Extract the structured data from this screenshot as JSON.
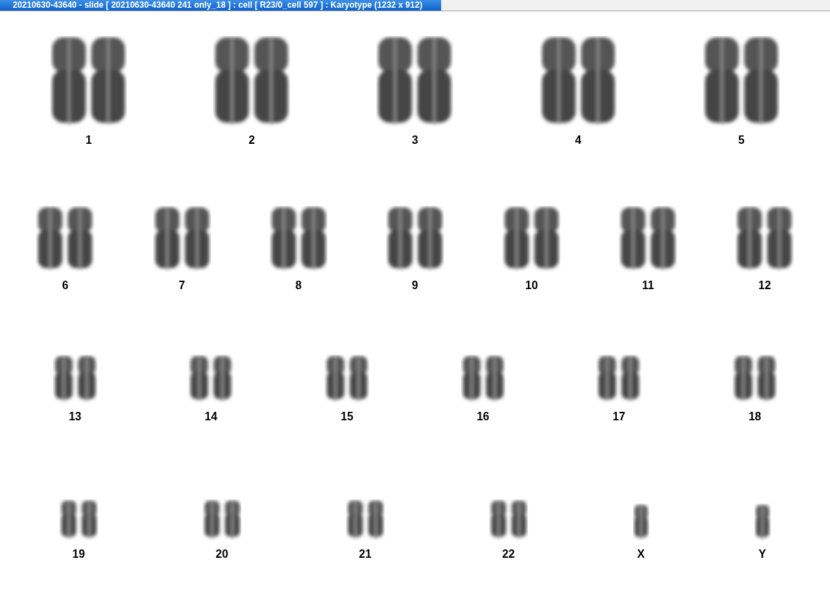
{
  "window": {
    "title": "20210630-43640 - slide [ 20210630-43640 241 only_18 ] : cell [ R23/0_cell 597 ] : Karyotype  (1232 x 912)"
  },
  "karyotype": {
    "rows": [
      {
        "items": [
          {
            "label": "1",
            "kind": "pair"
          },
          {
            "label": "2",
            "kind": "pair"
          },
          {
            "label": "3",
            "kind": "pair"
          },
          {
            "label": "4",
            "kind": "pair"
          },
          {
            "label": "5",
            "kind": "pair"
          }
        ]
      },
      {
        "items": [
          {
            "label": "6",
            "kind": "pair"
          },
          {
            "label": "7",
            "kind": "pair"
          },
          {
            "label": "8",
            "kind": "pair"
          },
          {
            "label": "9",
            "kind": "pair"
          },
          {
            "label": "10",
            "kind": "pair"
          },
          {
            "label": "11",
            "kind": "pair"
          },
          {
            "label": "12",
            "kind": "pair"
          }
        ]
      },
      {
        "items": [
          {
            "label": "13",
            "kind": "pair"
          },
          {
            "label": "14",
            "kind": "pair"
          },
          {
            "label": "15",
            "kind": "pair"
          },
          {
            "label": "16",
            "kind": "pair"
          },
          {
            "label": "17",
            "kind": "pair"
          },
          {
            "label": "18",
            "kind": "pair"
          }
        ]
      },
      {
        "items": [
          {
            "label": "19",
            "kind": "pair"
          },
          {
            "label": "20",
            "kind": "pair"
          },
          {
            "label": "21",
            "kind": "pair"
          },
          {
            "label": "22",
            "kind": "pair"
          },
          {
            "label": "X",
            "kind": "single"
          },
          {
            "label": "Y",
            "kind": "single"
          }
        ]
      }
    ]
  }
}
